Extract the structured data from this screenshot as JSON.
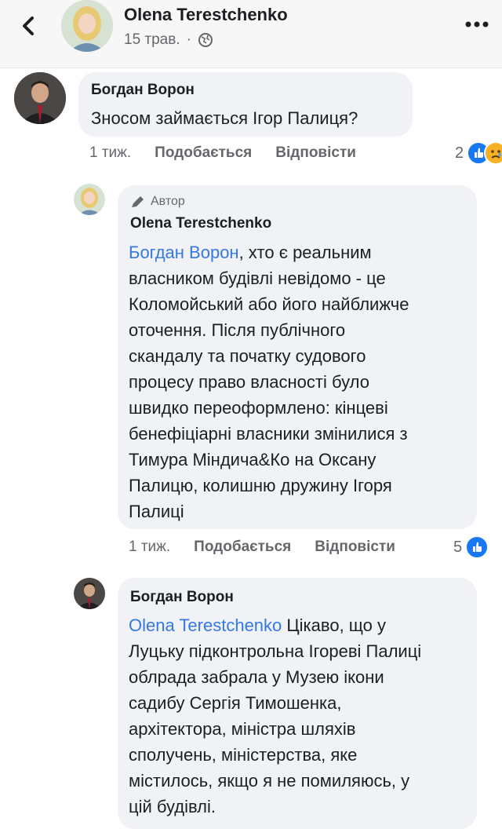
{
  "header": {
    "author": "Olena Terestchenko",
    "date": "15 трав.",
    "separator": "·",
    "privacy_icon": "globe-icon",
    "more_icon": "more-dots-icon",
    "back_icon": "back-chevron-icon"
  },
  "comments": [
    {
      "author": "Богдан Ворон",
      "text": "Зносом займається Ігор Палиця?",
      "time": "1 тиж.",
      "like_label": "Подобається",
      "reply_label": "Відповісти",
      "reaction_count": "2",
      "reactions": [
        "like",
        "sad"
      ]
    },
    {
      "badge": "Автор",
      "author": "Olena Terestchenko",
      "mention": "Богдан Ворон",
      "line1_rest": ", хто є реальним",
      "lines": [
        "власником будівлі невідомо - це",
        "Коломойський або його найближче",
        "оточення. Після публічного",
        "скандалу та початку судового",
        "процесу право власності було",
        "швидко переоформлено: кінцеві",
        "бенефіціарні власники змінилися з",
        "Тимура Міндича&Ко на Оксану",
        "Палицю, колишню дружину Ігоря",
        "Палиці"
      ],
      "time": "1 тиж.",
      "like_label": "Подобається",
      "reply_label": "Відповісти",
      "reaction_count": "5",
      "reactions": [
        "like"
      ]
    },
    {
      "author": "Богдан Ворон",
      "mention": "Olena Terestchenko",
      "line1_rest": " Цікаво, що у",
      "lines": [
        "Луцьку підконтрольна Ігореві Палиці",
        "облрада забрала у Музею ікони",
        "садибу Сергія Тимошенка,",
        "архітектора, міністра шляхів",
        "сполучень, міністерства, яке",
        "містилось, якщо я не помиляюсь, у",
        "цій будівлі."
      ]
    }
  ],
  "colors": {
    "link": "#3578e5",
    "bubble": "#f0f2f5",
    "meta": "#65676b",
    "like": "#1877f2",
    "sad": "#f7b125"
  }
}
